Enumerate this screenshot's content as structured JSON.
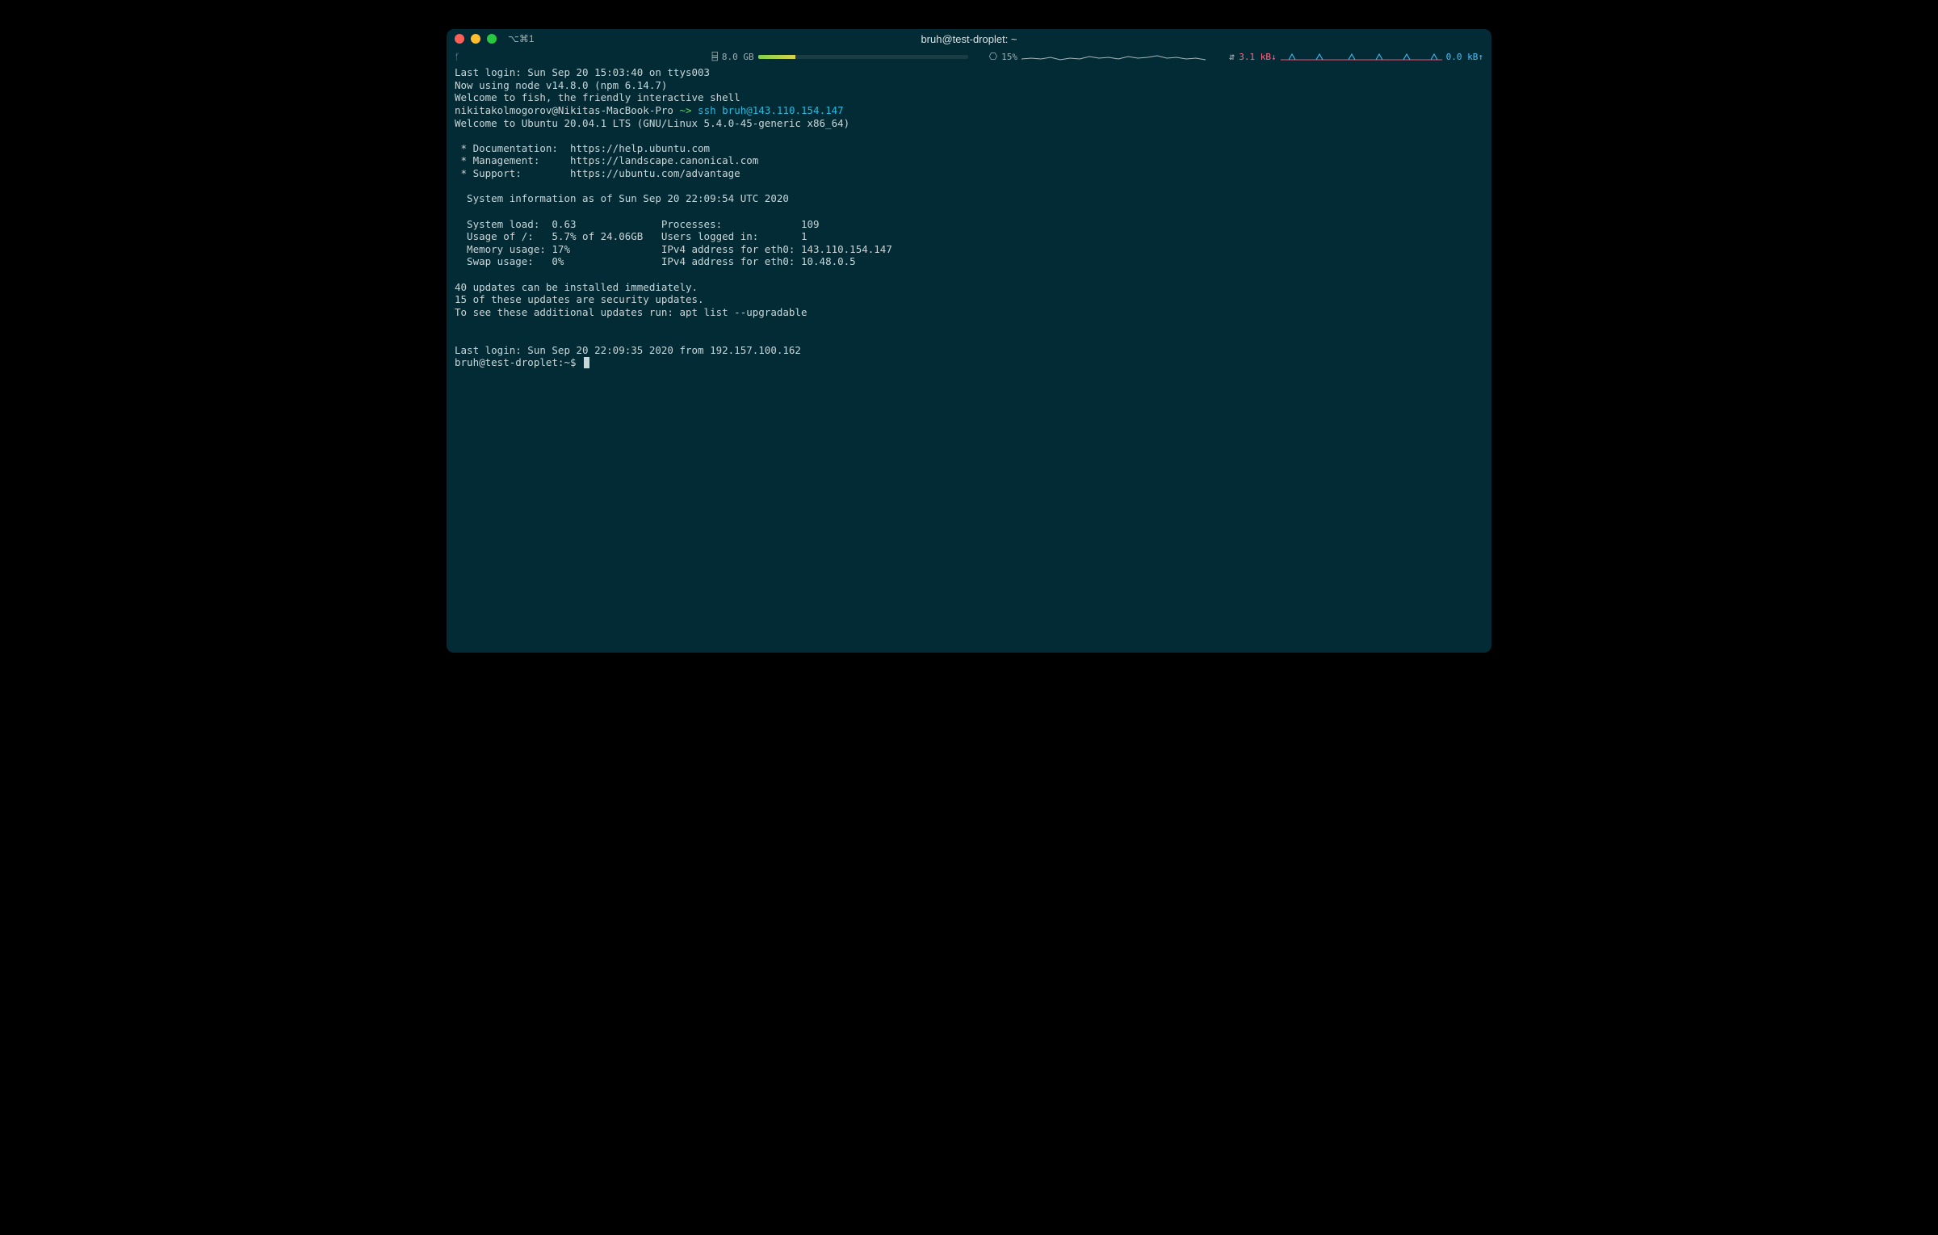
{
  "window": {
    "title": "bruh@test-droplet: ~",
    "tab_shortcut": "⌥⌘1"
  },
  "status": {
    "branch_symbol": "ᚶ",
    "mem_icon": "⌸",
    "mem_value": "8.0 GB",
    "mem_fill_pct": 18,
    "cpu_icon": "⎔",
    "cpu_value": "15%",
    "net_icon": "⇵",
    "net_down": "3.1 kB↓",
    "net_up": "0.0 kB↑"
  },
  "terminal": {
    "lines": [
      {
        "t": "plain",
        "v": "Last login: Sun Sep 20 15:03:40 on ttys003"
      },
      {
        "t": "plain",
        "v": "Now using node v14.8.0 (npm 6.14.7)"
      },
      {
        "t": "plain",
        "v": "Welcome to fish, the friendly interactive shell"
      },
      {
        "t": "prompt1",
        "host": "nikitakolmogorov@Nikitas-MacBook-Pro",
        "tilde": " ~> ",
        "cmd": "ssh ",
        "arg": "bruh@143.110.154.147"
      },
      {
        "t": "plain",
        "v": "Welcome to Ubuntu 20.04.1 LTS (GNU/Linux 5.4.0-45-generic x86_64)"
      },
      {
        "t": "blank"
      },
      {
        "t": "plain",
        "v": " * Documentation:  https://help.ubuntu.com"
      },
      {
        "t": "plain",
        "v": " * Management:     https://landscape.canonical.com"
      },
      {
        "t": "plain",
        "v": " * Support:        https://ubuntu.com/advantage"
      },
      {
        "t": "blank"
      },
      {
        "t": "plain",
        "v": "  System information as of Sun Sep 20 22:09:54 UTC 2020"
      },
      {
        "t": "blank"
      },
      {
        "t": "plain",
        "v": "  System load:  0.63              Processes:             109"
      },
      {
        "t": "plain",
        "v": "  Usage of /:   5.7% of 24.06GB   Users logged in:       1"
      },
      {
        "t": "plain",
        "v": "  Memory usage: 17%               IPv4 address for eth0: 143.110.154.147"
      },
      {
        "t": "plain",
        "v": "  Swap usage:   0%                IPv4 address for eth0: 10.48.0.5"
      },
      {
        "t": "blank"
      },
      {
        "t": "plain",
        "v": "40 updates can be installed immediately."
      },
      {
        "t": "plain",
        "v": "15 of these updates are security updates."
      },
      {
        "t": "plain",
        "v": "To see these additional updates run: apt list --upgradable"
      },
      {
        "t": "blank"
      },
      {
        "t": "blank"
      },
      {
        "t": "plain",
        "v": "Last login: Sun Sep 20 22:09:35 2020 from 192.157.100.162"
      },
      {
        "t": "prompt2",
        "prompt": "bruh@test-droplet:",
        "tilde": "~",
        "dollar": "$ "
      }
    ]
  }
}
